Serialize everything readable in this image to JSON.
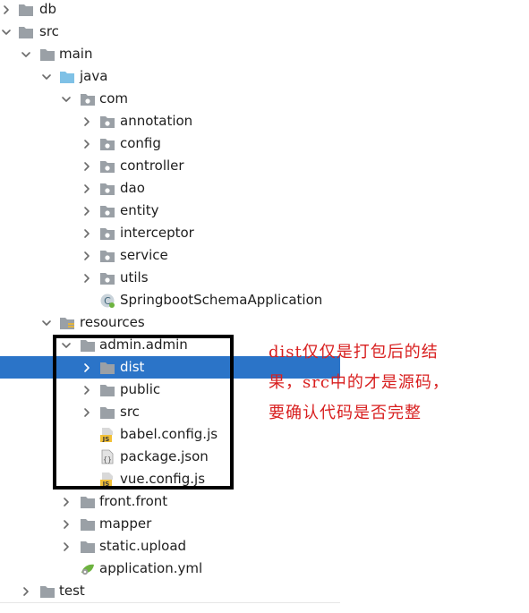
{
  "colors": {
    "selection": "#2b74c8",
    "annotation": "#d81f1f",
    "box": "#000000",
    "folder_gray": "#9aa0a6",
    "folder_blue": "#7fc1e6"
  },
  "tree": [
    {
      "label": "db",
      "level": 0,
      "chevron": "right",
      "icon": "folder-icon"
    },
    {
      "label": "src",
      "level": 0,
      "chevron": "down",
      "icon": "folder-icon"
    },
    {
      "label": "main",
      "level": 1,
      "chevron": "down",
      "icon": "folder-icon"
    },
    {
      "label": "java",
      "level": 2,
      "chevron": "down",
      "icon": "source-folder-icon"
    },
    {
      "label": "com",
      "level": 3,
      "chevron": "down",
      "icon": "package-icon"
    },
    {
      "label": "annotation",
      "level": 4,
      "chevron": "right",
      "icon": "package-icon"
    },
    {
      "label": "config",
      "level": 4,
      "chevron": "right",
      "icon": "package-icon"
    },
    {
      "label": "controller",
      "level": 4,
      "chevron": "right",
      "icon": "package-icon"
    },
    {
      "label": "dao",
      "level": 4,
      "chevron": "right",
      "icon": "package-icon"
    },
    {
      "label": "entity",
      "level": 4,
      "chevron": "right",
      "icon": "package-icon"
    },
    {
      "label": "interceptor",
      "level": 4,
      "chevron": "right",
      "icon": "package-icon"
    },
    {
      "label": "service",
      "level": 4,
      "chevron": "right",
      "icon": "package-icon"
    },
    {
      "label": "utils",
      "level": 4,
      "chevron": "right",
      "icon": "package-icon"
    },
    {
      "label": "SpringbootSchemaApplication",
      "level": 4,
      "chevron": "none",
      "icon": "spring-class-icon"
    },
    {
      "label": "resources",
      "level": 2,
      "chevron": "down",
      "icon": "resources-folder-icon"
    },
    {
      "label": "admin.admin",
      "level": 3,
      "chevron": "down",
      "icon": "folder-icon"
    },
    {
      "label": "dist",
      "level": 4,
      "chevron": "right",
      "icon": "folder-icon",
      "selected": true
    },
    {
      "label": "public",
      "level": 4,
      "chevron": "right",
      "icon": "folder-icon"
    },
    {
      "label": "src",
      "level": 4,
      "chevron": "right",
      "icon": "folder-icon"
    },
    {
      "label": "babel.config.js",
      "level": 4,
      "chevron": "none",
      "icon": "js-file-icon"
    },
    {
      "label": "package.json",
      "level": 4,
      "chevron": "none",
      "icon": "json-file-icon"
    },
    {
      "label": "vue.config.js",
      "level": 4,
      "chevron": "none",
      "icon": "js-file-icon"
    },
    {
      "label": "front.front",
      "level": 3,
      "chevron": "right",
      "icon": "folder-icon"
    },
    {
      "label": "mapper",
      "level": 3,
      "chevron": "right",
      "icon": "folder-icon"
    },
    {
      "label": "static.upload",
      "level": 3,
      "chevron": "right",
      "icon": "folder-icon"
    },
    {
      "label": "application.yml",
      "level": 3,
      "chevron": "none",
      "icon": "yml-file-icon"
    },
    {
      "label": "test",
      "level": 1,
      "chevron": "right",
      "icon": "folder-icon"
    }
  ],
  "annotation": {
    "lines": [
      "dist仅仅是打包后的结",
      "果，src中的才是源码，",
      "要确认代码是否完整"
    ]
  }
}
